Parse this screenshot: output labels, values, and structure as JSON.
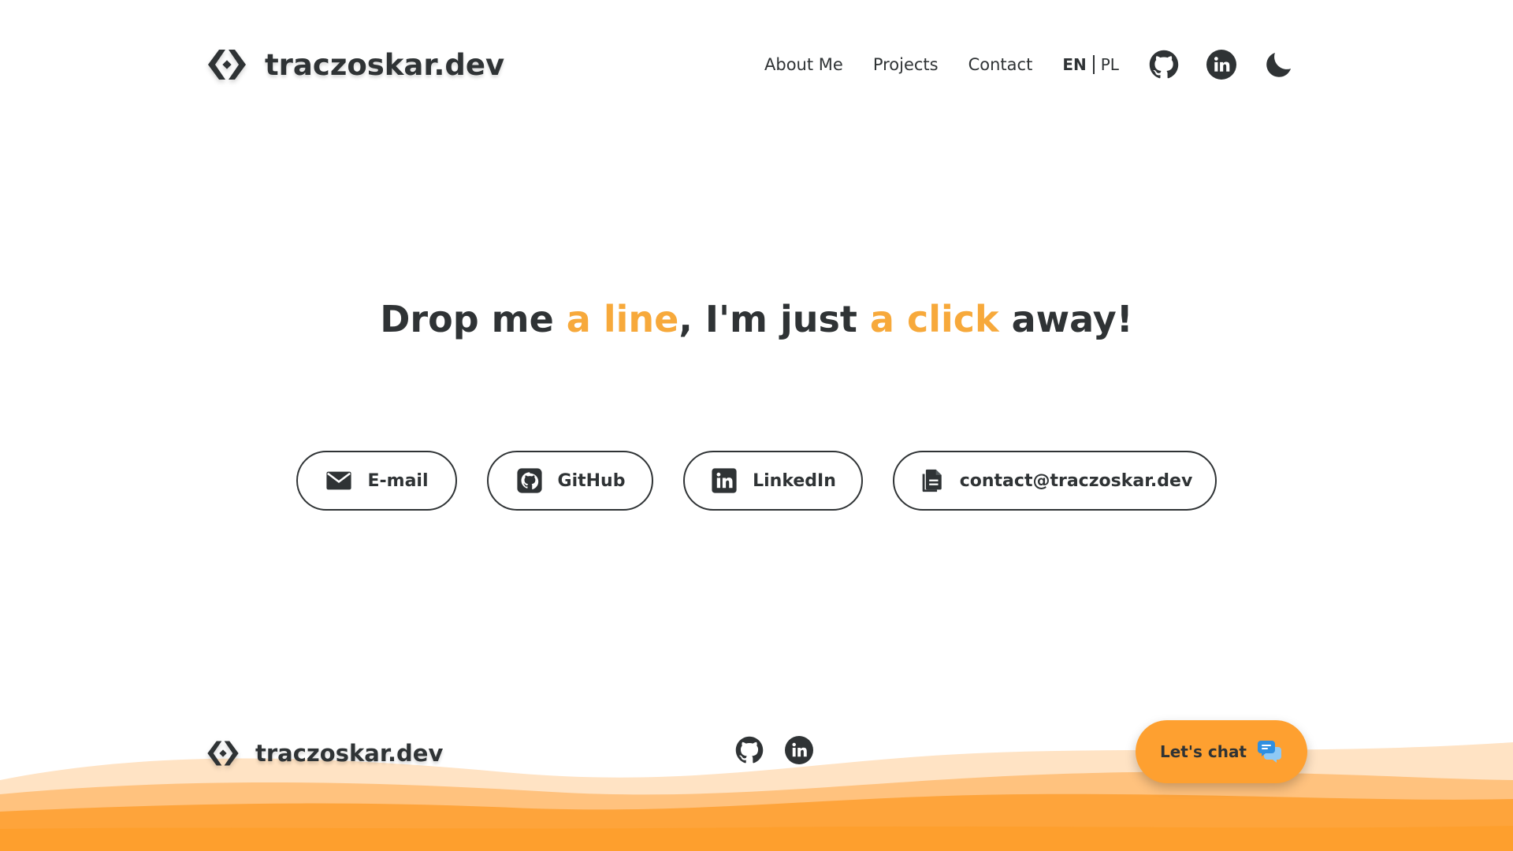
{
  "site": {
    "brand": "traczoskar.dev"
  },
  "nav": {
    "links": [
      {
        "label": "About Me",
        "icon": ""
      },
      {
        "label": "Projects",
        "icon": ""
      },
      {
        "label": "Contact",
        "icon": ""
      }
    ],
    "lang": {
      "active": "EN",
      "other": "PL"
    },
    "icons": [
      "github-icon",
      "linkedin-icon",
      "moon-icon"
    ]
  },
  "hero": {
    "part1": "Drop me ",
    "accent1": "a line",
    "part2": ", I'm just ",
    "accent2": "a click",
    "part3": " away!"
  },
  "contact_buttons": {
    "email": {
      "label": "E-mail",
      "icon": "envelope-icon"
    },
    "github": {
      "label": "GitHub",
      "icon": "github-icon"
    },
    "linkedin": {
      "label": "LinkedIn",
      "icon": "linkedin-icon"
    },
    "address": {
      "label": "contact@traczoskar.dev",
      "icon": "copy-icon"
    }
  },
  "footer": {
    "brand": "traczoskar.dev",
    "icons": [
      "github-icon",
      "linkedin-icon"
    ],
    "chat_label": "Let's chat",
    "chat_icon": "chat-bubbles-icon"
  },
  "colors": {
    "text": "#2f3335",
    "accent": "#f7a93b",
    "chat_button": "#fea030",
    "wave_light": "#ffe3c4",
    "wave_mid": "#ffc27e",
    "wave_dark": "#fea43b"
  }
}
